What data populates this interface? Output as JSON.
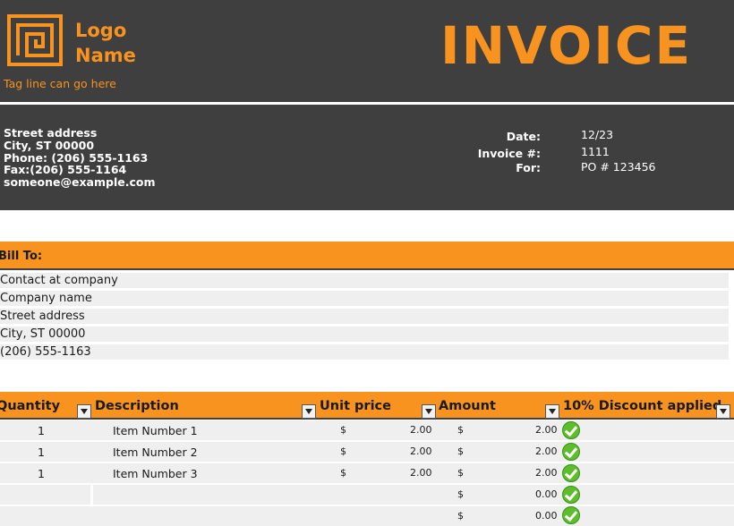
{
  "brand": {
    "logo_line1": "Logo",
    "logo_line2": "Name",
    "tagline": "Tag line can go here",
    "accent": "#f7931e",
    "dark": "#3f3f3f"
  },
  "title": "INVOICE",
  "company": {
    "street": "Street address",
    "city": "City, ST  00000",
    "phone": "Phone: (206) 555-1163",
    "fax": "Fax:(206) 555-1164",
    "email": "someone@example.com"
  },
  "meta": {
    "date_label": "Date:",
    "date_value": "12/23",
    "invoice_label": "Invoice #:",
    "invoice_value": "1111",
    "for_label": "For:",
    "for_value": "PO # 123456"
  },
  "bill_to": {
    "label": "Bill To:",
    "lines": [
      "Contact at company",
      "Company name",
      "Street address",
      "City, ST  00000",
      "(206) 555-1163"
    ]
  },
  "table": {
    "headers": [
      "Quantity",
      "Description",
      "Unit price",
      "Amount",
      "10% Discount applied"
    ],
    "rows": [
      {
        "qty": "1",
        "desc": "Item Number 1",
        "currency": "$",
        "unit": "2.00",
        "amount_currency": "$",
        "amount": "2.00"
      },
      {
        "qty": "1",
        "desc": "Item Number 2",
        "currency": "$",
        "unit": "2.00",
        "amount_currency": "$",
        "amount": "2.00"
      },
      {
        "qty": "1",
        "desc": "Item Number 3",
        "currency": "$",
        "unit": "2.00",
        "amount_currency": "$",
        "amount": "2.00"
      },
      {
        "qty": "",
        "desc": "",
        "currency": "",
        "unit": "",
        "amount_currency": "$",
        "amount": "0.00"
      },
      {
        "qty": "",
        "desc": "",
        "currency": "",
        "unit": "",
        "amount_currency": "$",
        "amount": "0.00"
      }
    ],
    "discount_icon": "check-circle-icon"
  }
}
